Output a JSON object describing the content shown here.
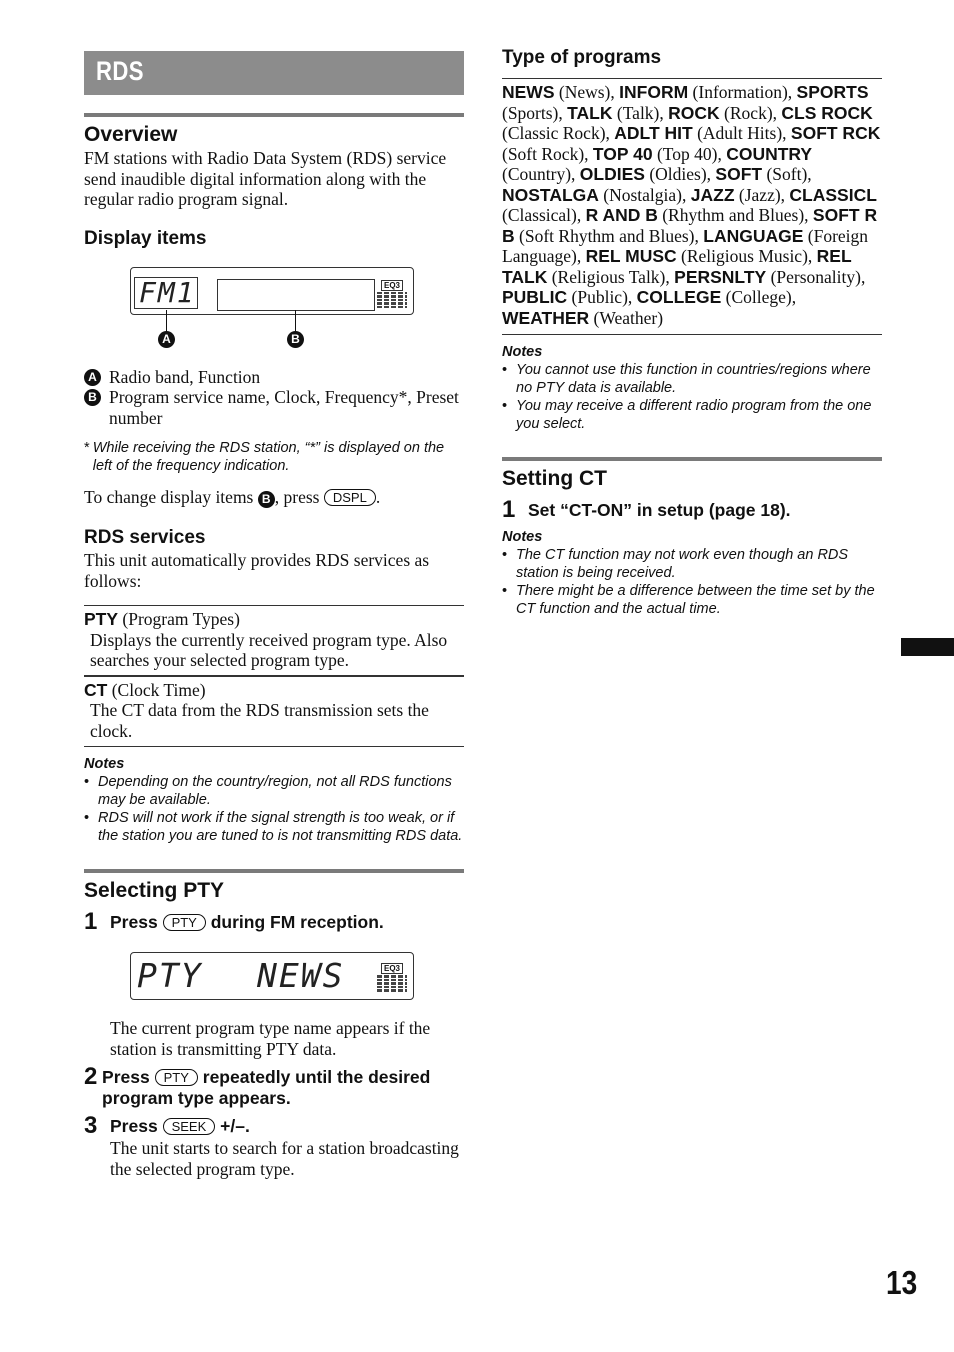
{
  "page": {
    "number": "13"
  },
  "chapter": {
    "title": "RDS"
  },
  "overview": {
    "title": "Overview",
    "body": "FM stations with Radio Data System (RDS) service send inaudible digital information along with the regular radio program signal."
  },
  "display_items": {
    "title": "Display items",
    "lcd": {
      "band_text": "FM1",
      "eq_label": "EQ3"
    },
    "callouts": [
      {
        "marker": "A",
        "text": "Radio band, Function"
      },
      {
        "marker": "B",
        "text": "Program service name, Clock, Frequency*, Preset number"
      }
    ],
    "footnote_mark": "*",
    "footnote": "While receiving the RDS station, “*” is displayed on the left of the frequency indication.",
    "change_prefix": "To change display items",
    "change_marker": "B",
    "change_mid": ", press",
    "change_key": "DSPL",
    "change_suffix": "."
  },
  "rds_services": {
    "title": "RDS services",
    "intro": "This unit automatically provides RDS services as follows:",
    "items": [
      {
        "code": "PTY",
        "name": "(Program Types)",
        "desc": "Displays the currently received program type. Also searches your selected program type."
      },
      {
        "code": "CT",
        "name": "(Clock Time)",
        "desc": "The CT data from the RDS transmission sets the clock."
      }
    ],
    "notes_title": "Notes",
    "notes": [
      "Depending on the country/region, not all RDS functions may be available.",
      "RDS will not work if the signal strength is too weak, or if the station you are tuned to is not transmitting RDS data."
    ]
  },
  "selecting_pty": {
    "title": "Selecting PTY",
    "steps": [
      {
        "num": "1",
        "pre": "Press",
        "key": "PTY",
        "post": "during FM reception."
      },
      {
        "num": "2",
        "pre": "Press",
        "key": "PTY",
        "post": "repeatedly until the desired program type appears."
      },
      {
        "num": "3",
        "pre": "Press",
        "key": "SEEK",
        "post": "+/–."
      }
    ],
    "lcd": {
      "left_text": "PTY",
      "right_text": "NEWS",
      "eq_label": "EQ3"
    },
    "step1_body": "The current program type name appears if the station is transmitting PTY data.",
    "step3_body": "The unit starts to search for a station broadcasting the selected program type."
  },
  "type_of_programs": {
    "title": "Type of programs",
    "programs": [
      {
        "code": "NEWS",
        "name": "(News)"
      },
      {
        "code": "INFORM",
        "name": "(Information)"
      },
      {
        "code": "SPORTS",
        "name": "(Sports)"
      },
      {
        "code": "TALK",
        "name": "(Talk)"
      },
      {
        "code": "ROCK",
        "name": "(Rock)"
      },
      {
        "code": "CLS ROCK",
        "name": "(Classic Rock)"
      },
      {
        "code": "ADLT HIT",
        "name": "(Adult Hits)"
      },
      {
        "code": "SOFT RCK",
        "name": "(Soft Rock)"
      },
      {
        "code": "TOP 40",
        "name": "(Top 40)"
      },
      {
        "code": "COUNTRY",
        "name": "(Country)"
      },
      {
        "code": "OLDIES",
        "name": "(Oldies)"
      },
      {
        "code": "SOFT",
        "name": "(Soft)"
      },
      {
        "code": "NOSTALGA",
        "name": "(Nostalgia)"
      },
      {
        "code": "JAZZ",
        "name": "(Jazz)"
      },
      {
        "code": "CLASSICL",
        "name": "(Classical)"
      },
      {
        "code": "R AND B",
        "name": "(Rhythm and Blues)"
      },
      {
        "code": "SOFT R B",
        "name": "(Soft Rhythm and Blues)"
      },
      {
        "code": "LANGUAGE",
        "name": "(Foreign Language)"
      },
      {
        "code": "REL MUSC",
        "name": "(Religious Music)"
      },
      {
        "code": "REL TALK",
        "name": "(Religious Talk)"
      },
      {
        "code": "PERSNLTY",
        "name": "(Personality)"
      },
      {
        "code": "PUBLIC",
        "name": "(Public)"
      },
      {
        "code": "COLLEGE",
        "name": "(College)"
      },
      {
        "code": "WEATHER",
        "name": "(Weather)"
      }
    ],
    "notes_title": "Notes",
    "notes": [
      "You cannot use this function in countries/regions where no PTY data is available.",
      "You may receive a different radio program from the one you select."
    ]
  },
  "setting_ct": {
    "title": "Setting CT",
    "step": {
      "num": "1",
      "text": "Set “CT-ON” in setup (page 18)."
    },
    "notes_title": "Notes",
    "notes": [
      "The CT function may not work even though an RDS station is being received.",
      "There might be a difference between the time set by the CT function and the actual time."
    ]
  }
}
